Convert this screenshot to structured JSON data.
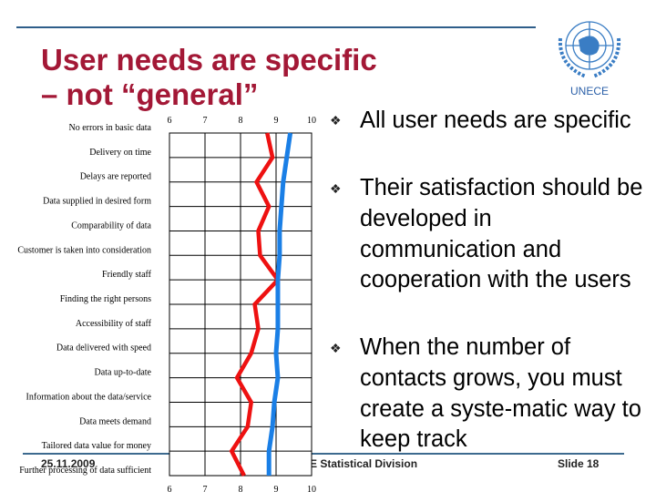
{
  "slide": {
    "title_line1": "User needs are specific",
    "title_line2": "– not “general”",
    "logo_text": "UNECE",
    "bullets": [
      {
        "icon": "diamond-bullet-icon",
        "text": "All user needs are specific"
      },
      {
        "icon": "diamond-bullet-icon",
        "text": "Their satisfaction should be developed in communication and cooperation with the users"
      },
      {
        "icon": "diamond-bullet-icon",
        "text": "When the number of contacts grows, you must create a syste-matic way to keep track"
      }
    ],
    "footer": {
      "date": "25.11.2009",
      "org": "E Statistical Division",
      "slide": "Slide 18"
    }
  },
  "chart_data": {
    "type": "line",
    "orientation": "horizontal",
    "categories": [
      "No errors in basic data",
      "Delivery on time",
      "Delays are reported",
      "Data supplied in desired form",
      "Comparability of data",
      "Customer is taken into consideration",
      "Friendly staff",
      "Finding the right persons",
      "Accessibility of staff",
      "Data delivered with speed",
      "Data up-to-date",
      "Information about the data/service",
      "Data meets demand",
      "Tailored data value for money",
      "Further processing of data sufficient"
    ],
    "xlim": [
      6,
      10
    ],
    "xticks": [
      "6",
      "7",
      "8",
      "9",
      "10"
    ],
    "grid": true,
    "series": [
      {
        "color": "#ee1111",
        "values": [
          8.75,
          8.9,
          8.45,
          8.8,
          8.5,
          8.55,
          9.05,
          8.4,
          8.5,
          8.3,
          7.9,
          8.3,
          8.2,
          7.75,
          8.1
        ]
      },
      {
        "color": "#1a7fe6",
        "values": [
          9.4,
          9.3,
          9.2,
          9.15,
          9.1,
          9.1,
          9.05,
          9.05,
          9.05,
          9.0,
          9.05,
          8.95,
          8.9,
          8.8,
          8.8
        ]
      }
    ]
  }
}
